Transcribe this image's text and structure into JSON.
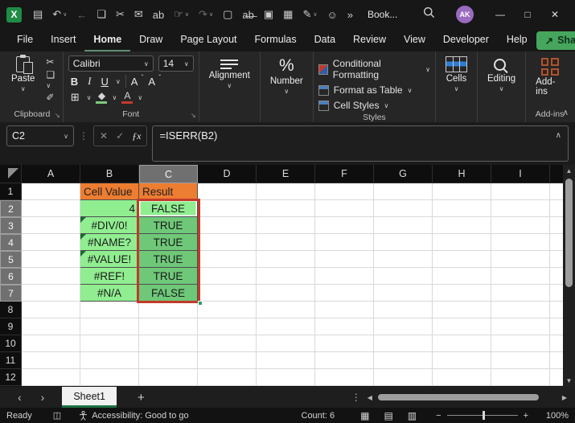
{
  "icons": {
    "chevron_down": "∨",
    "chevron_up": "∧",
    "ellipsis_v": "⋮",
    "cancel": "✕",
    "confirm": "✓",
    "fx": "ƒx",
    "nav_prev": "‹",
    "nav_next": "›",
    "scroll_left": "◀",
    "scroll_right": "▶",
    "scroll_up": "▲",
    "scroll_down": "▼",
    "minus": "−",
    "plus": "+",
    "share_arrow": "↗"
  },
  "titlebar": {
    "title": "Book...",
    "avatar": "AK",
    "qat": [
      {
        "name": "save-icon",
        "glyph": "▤"
      },
      {
        "name": "undo-icon",
        "glyph": "↶",
        "chevron": true
      },
      {
        "name": "back-icon",
        "glyph": "←",
        "dim": true
      },
      {
        "name": "copy-icon",
        "glyph": "❏"
      },
      {
        "name": "cut-icon",
        "glyph": "✂"
      },
      {
        "name": "picture-mail-icon",
        "glyph": "✉"
      },
      {
        "name": "spellcheck-icon",
        "glyph": "ab"
      },
      {
        "name": "touch-mode-icon",
        "glyph": "☞",
        "chevron": true
      },
      {
        "name": "redo-icon",
        "glyph": "↷",
        "dim": true,
        "chevron": true
      },
      {
        "name": "new-file-icon",
        "glyph": "▢"
      },
      {
        "name": "strikethrough-icon",
        "glyph": "a̶b̶"
      },
      {
        "name": "camera-icon",
        "glyph": "▣"
      },
      {
        "name": "sheet-lookup-icon",
        "glyph": "▦"
      },
      {
        "name": "ink-pen-icon",
        "glyph": "✎",
        "chevron": true
      },
      {
        "name": "find-person-icon",
        "glyph": "☺"
      },
      {
        "name": "overflow-icon",
        "glyph": "»"
      }
    ],
    "window": {
      "minimize": "—",
      "maximize": "□",
      "close": "✕"
    }
  },
  "tabs": {
    "items": [
      "File",
      "Insert",
      "Home",
      "Draw",
      "Page Layout",
      "Formulas",
      "Data",
      "Review",
      "View",
      "Developer",
      "Help"
    ],
    "active": "Home",
    "share_label": "Share"
  },
  "ribbon": {
    "clipboard": {
      "label": "Clipboard",
      "paste": "Paste"
    },
    "font": {
      "label": "Font",
      "name": "Calibri",
      "size": "14",
      "bold": "B",
      "italic": "I",
      "underline": "U",
      "grow": "A",
      "shrink": "A"
    },
    "alignment": {
      "label": "Alignment"
    },
    "number": {
      "label": "Number",
      "glyph": "%"
    },
    "styles": {
      "label": "Styles",
      "items": [
        {
          "name": "conditional-formatting-button",
          "icon": "conditional-formatting-icon",
          "label": "Conditional Formatting"
        },
        {
          "name": "format-as-table-button",
          "icon": "format-as-table-icon",
          "label": "Format as Table"
        },
        {
          "name": "cell-styles-button",
          "icon": "cell-styles-icon",
          "label": "Cell Styles"
        }
      ]
    },
    "cells": {
      "label": "Cells"
    },
    "editing": {
      "label": "Editing"
    },
    "addins": {
      "label": "Add-ins",
      "group_label": "Add-ins"
    }
  },
  "formula_bar": {
    "name_box": "C2",
    "formula": "=ISERR(B2)"
  },
  "grid": {
    "columns": [
      "A",
      "B",
      "C",
      "D",
      "E",
      "F",
      "G",
      "H",
      "I"
    ],
    "selected_column": "C",
    "selected_rows": [
      2,
      3,
      4,
      5,
      6,
      7
    ],
    "colors": {
      "orange": "#ED7D31",
      "pale": "#90EE90",
      "tint": "#6EC878",
      "selection_border": "#C13A2A",
      "header_text": "#1F1F1F"
    },
    "rows": [
      {
        "n": 1,
        "cells": {
          "B": {
            "text": "Cell Value",
            "bg": "orange"
          },
          "C": {
            "text": "Result",
            "bg": "orange"
          }
        }
      },
      {
        "n": 2,
        "cells": {
          "B": {
            "text": "4",
            "bg": "pale",
            "align": "right"
          },
          "C": {
            "text": "FALSE",
            "bg": "pale",
            "align": "center",
            "active": true
          }
        }
      },
      {
        "n": 3,
        "cells": {
          "B": {
            "text": "#DIV/0!",
            "bg": "pale",
            "align": "center",
            "flag": true
          },
          "C": {
            "text": "TRUE",
            "bg": "tint",
            "align": "center"
          }
        }
      },
      {
        "n": 4,
        "cells": {
          "B": {
            "text": "#NAME?",
            "bg": "pale",
            "align": "center",
            "flag": true
          },
          "C": {
            "text": "TRUE",
            "bg": "tint",
            "align": "center"
          }
        }
      },
      {
        "n": 5,
        "cells": {
          "B": {
            "text": "#VALUE!",
            "bg": "pale",
            "align": "center",
            "flag": true
          },
          "C": {
            "text": "TRUE",
            "bg": "tint",
            "align": "center"
          }
        }
      },
      {
        "n": 6,
        "cells": {
          "B": {
            "text": "#REF!",
            "bg": "pale",
            "align": "center"
          },
          "C": {
            "text": "TRUE",
            "bg": "tint",
            "align": "center"
          }
        }
      },
      {
        "n": 7,
        "cells": {
          "B": {
            "text": "#N/A",
            "bg": "pale",
            "align": "center"
          },
          "C": {
            "text": "FALSE",
            "bg": "tint",
            "align": "center"
          }
        }
      },
      {
        "n": 8,
        "cells": {}
      },
      {
        "n": 9,
        "cells": {}
      },
      {
        "n": 10,
        "cells": {}
      },
      {
        "n": 11,
        "cells": {}
      },
      {
        "n": 12,
        "cells": {}
      }
    ]
  },
  "sheet_bar": {
    "active": "Sheet1"
  },
  "status_bar": {
    "ready": "Ready",
    "accessibility": "Accessibility: Good to go",
    "count": "Count: 6",
    "zoom": "100%",
    "views": [
      {
        "name": "normal-view-icon",
        "glyph": "▦"
      },
      {
        "name": "page-layout-view-icon",
        "glyph": "▤"
      },
      {
        "name": "page-break-view-icon",
        "glyph": "▥"
      }
    ]
  }
}
